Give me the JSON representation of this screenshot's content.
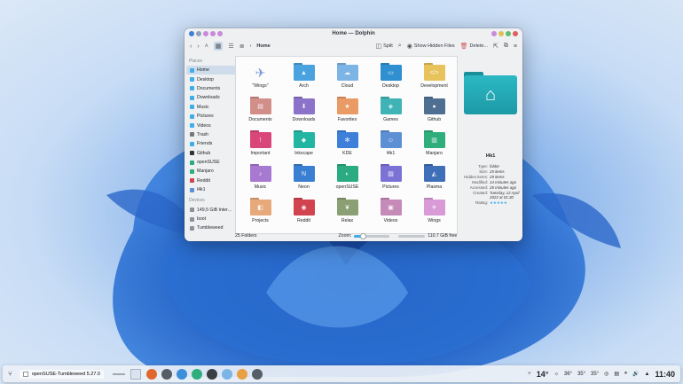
{
  "window": {
    "title": "Home — Dolphin",
    "toolbar": {
      "breadcrumb": "Home",
      "split_label": "Split",
      "hidden_label": "Show Hidden Files",
      "delete_label": "Delete..."
    },
    "sidebar": {
      "places_heading": "Places",
      "places": [
        "Home",
        "Desktop",
        "Documents",
        "Downloads",
        "Music",
        "Pictures",
        "Videos",
        "Trash",
        "Friends",
        "Github",
        "openSUSE",
        "Manjaro",
        "Reddit",
        "l4k1"
      ],
      "devices_heading": "Devices",
      "devices": [
        "149,5 GiB Inter...",
        "boot",
        "Tumbleweed"
      ]
    },
    "folders": [
      {
        "name": "\"Wings\"",
        "color": "#ffffff",
        "icon": "wings-icon"
      },
      {
        "name": "Arch",
        "color": "#4aa3df",
        "icon": "arch-icon"
      },
      {
        "name": "Cloud",
        "color": "#7db4e6",
        "icon": "cloud-icon"
      },
      {
        "name": "Desktop",
        "color": "#2f8fd0",
        "icon": "desktop-icon"
      },
      {
        "name": "Development",
        "color": "#e8c25a",
        "icon": "code-icon"
      },
      {
        "name": "Documents",
        "color": "#d28f8a",
        "icon": "document-icon"
      },
      {
        "name": "Downloads",
        "color": "#8b73c9",
        "icon": "download-icon"
      },
      {
        "name": "Favorites",
        "color": "#e99a65",
        "icon": "star-icon"
      },
      {
        "name": "Games",
        "color": "#3fb3b5",
        "icon": "gamepad-icon"
      },
      {
        "name": "Github",
        "color": "#4e6e92",
        "icon": "github-icon"
      },
      {
        "name": "Important",
        "color": "#d9467a",
        "icon": "exclamation-icon"
      },
      {
        "name": "Inkscape",
        "color": "#22b6a2",
        "icon": "inkscape-icon"
      },
      {
        "name": "KDE",
        "color": "#3d7fd9",
        "icon": "kde-icon"
      },
      {
        "name": "l4k1",
        "color": "#5d8fd4",
        "icon": "avatar-icon"
      },
      {
        "name": "Manjaro",
        "color": "#2fae7c",
        "icon": "manjaro-icon"
      },
      {
        "name": "Music",
        "color": "#a879d0",
        "icon": "music-icon"
      },
      {
        "name": "Neon",
        "color": "#3b7fd2",
        "icon": "neon-icon"
      },
      {
        "name": "openSUSE",
        "color": "#2bab82",
        "icon": "opensuse-icon"
      },
      {
        "name": "Pictures",
        "color": "#7b72d6",
        "icon": "picture-icon"
      },
      {
        "name": "Plasma",
        "color": "#3f6fb8",
        "icon": "plasma-icon"
      },
      {
        "name": "Projects",
        "color": "#e7a97a",
        "icon": "projects-icon"
      },
      {
        "name": "Reddit",
        "color": "#d1434e",
        "icon": "reddit-icon"
      },
      {
        "name": "Relax",
        "color": "#8a9f73",
        "icon": "leaf-icon"
      },
      {
        "name": "Videos",
        "color": "#c58ab8",
        "icon": "video-icon"
      },
      {
        "name": "Wings",
        "color": "#d89bd8",
        "icon": "wings-icon"
      }
    ],
    "info_panel": {
      "name": "l4k1",
      "rows": [
        {
          "k": "Type:",
          "v": "folder"
        },
        {
          "k": "Size:",
          "v": "25 items"
        },
        {
          "k": "Hidden items:",
          "v": "29 items"
        },
        {
          "k": "Modified:",
          "v": "14 minutes ago"
        },
        {
          "k": "Accessed:",
          "v": "26 minutes ago"
        },
        {
          "k": "Created:",
          "v": "Tuesday, 12 April 2022 at 01:30"
        },
        {
          "k": "Rating:",
          "v": "★★★★★"
        }
      ]
    },
    "status": {
      "count": "25 Folders",
      "zoom_label": "Zoom:",
      "zoom_level": 0.25,
      "free_space": "110.7 GiB free"
    }
  },
  "taskbar": {
    "window_label": "openSUSE-Tumbleweed 5.27.0",
    "apps": [
      {
        "name": "firefox-icon",
        "color": "#e0682f"
      },
      {
        "name": "settings-icon",
        "color": "#555d66"
      },
      {
        "name": "browser-icon",
        "color": "#3d8fd9"
      },
      {
        "name": "store-icon",
        "color": "#2fae7c"
      },
      {
        "name": "terminal-icon",
        "color": "#3a3f44"
      },
      {
        "name": "color-icon",
        "color": "#7db4e6"
      },
      {
        "name": "files-icon",
        "color": "#e8a045"
      },
      {
        "name": "record-icon",
        "color": "#555d66"
      }
    ],
    "temp_weather": "14°",
    "temps": [
      "36°",
      "35°",
      "35°"
    ],
    "clock": "11:40"
  }
}
